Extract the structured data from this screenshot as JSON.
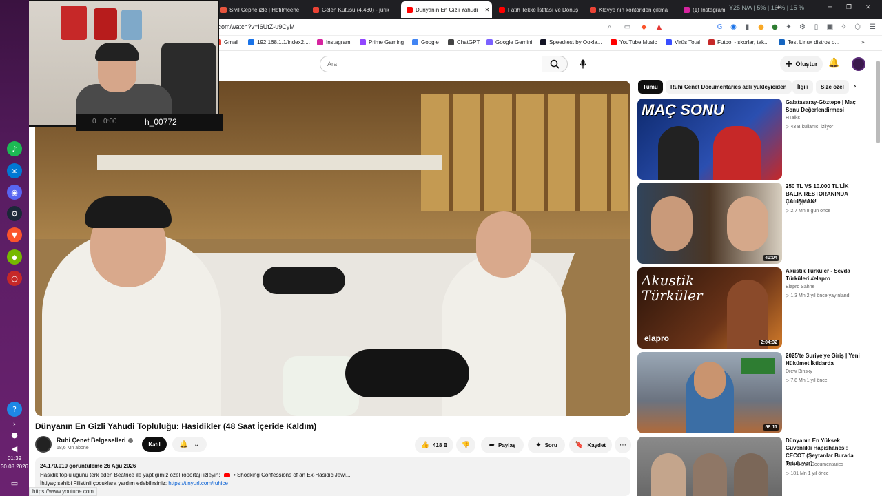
{
  "taskbar": {
    "time": "01:39",
    "date": "30.08.2026"
  },
  "browser": {
    "tabs": [
      {
        "label": "Sivil Cephe izle | Hdfilmcehe",
        "color": "#e8553e"
      },
      {
        "label": "Gelen Kutusu (4.430) - jurik",
        "color": "#ea4335"
      },
      {
        "label": "Dünyanın En Gizli Yahudi",
        "color": "#ff0000"
      },
      {
        "label": "Fatih Tekke İstifası ve Dönüş",
        "color": "#ff0000"
      },
      {
        "label": "Klavye nin kontorlden çıkma",
        "color": "#ea4335"
      },
      {
        "label": "(1) Instagram",
        "color": "#d6249f"
      }
    ],
    "tray_text": "Y25 N/A | 5% | 16 % | 15 %",
    "url": ".com/watch?v=I6UtZ-u9CyM",
    "bookmarks": [
      {
        "label": "Gmail",
        "color": "#ea4335"
      },
      {
        "label": "192.168.1.1/index2....",
        "color": "#1a73e8"
      },
      {
        "label": "Instagram",
        "color": "#d6249f"
      },
      {
        "label": "Prime Gaming",
        "color": "#9146ff"
      },
      {
        "label": "Google",
        "color": "#4285f4"
      },
      {
        "label": "ChatGPT",
        "color": "#444444"
      },
      {
        "label": "Google Gemini",
        "color": "#7b61ff"
      },
      {
        "label": "Speedtest by Ookla...",
        "color": "#141526"
      },
      {
        "label": "YouTube Music",
        "color": "#ff0000"
      },
      {
        "label": "Virüs Total",
        "color": "#394eff"
      },
      {
        "label": "Futbol - skorlar, tak...",
        "color": "#c62828"
      },
      {
        "label": "Test Linux distros o...",
        "color": "#1565c0"
      }
    ],
    "status_url": "https://www.youtube.com"
  },
  "webcam": {
    "counter_a": "0",
    "counter_b": "0:00",
    "username": "h_00772"
  },
  "youtube": {
    "search_placeholder": "Ara",
    "create_label": "Oluştur",
    "video_title": "Dünyanın En Gizli Yahudi Topluluğu: Hasidikler (48 Saat İçeride Kaldım)",
    "channel_name": "Ruhi Çenet Belgeselleri",
    "subscribers": "18,6 Mn abone",
    "join_label": "Katıl",
    "like_count": "418 B",
    "share_label": "Paylaş",
    "ask_label": "Soru",
    "save_label": "Kaydet",
    "description": {
      "stats": "24.170.010 görüntüleme  26 Ağu 2026",
      "line2": "Hasidik topluluğunu terk eden Beatrice ile yaptığımız özel röportajı izleyin:",
      "line2_link": "• Shocking Confessions of an Ex-Hasidic Jewi...",
      "line3": "İhtiyaç sahibi Filistinli çocuklara yardım edebilirsiniz: ",
      "line3_link": "https://tinyurl.com/ruhice"
    }
  },
  "sidebar": {
    "chips": [
      "Tümü",
      "Ruhi Cenet Documentaries adlı yükleyiciden",
      "İlgili",
      "Size özel"
    ],
    "recommendations": [
      {
        "title": "Galatasaray-Göztepe | Maç Sonu Değerlendirmesi",
        "channel": "HTalks",
        "meta": "▷ 43 B kullanıcı izliyor",
        "duration": "",
        "thumb_text": "MAÇ SONU",
        "thumb_color": "#1a3d8f"
      },
      {
        "title": "250 TL VS 10.000 TL'LİK BALIK RESTORANINDA ÇALIŞMAK!",
        "channel": "Orkun Işıtmak",
        "meta": "▷ 2,7 Mn   8 gün önce",
        "duration": "40:04",
        "thumb_text": "",
        "thumb_color": "#2f4a3a"
      },
      {
        "title": "Akustik Türküler - Sevda Türküleri #elapro",
        "channel": "Elapro Sahne",
        "meta": "▷ 1,3 Mn   2 yıl önce yayınlandı",
        "duration": "2:04:32",
        "thumb_text": "Akustik Türküler",
        "thumb_color": "#5a2a14"
      },
      {
        "title": "2025'te Suriye'ye Giriş | Yeni Hükümet İktidarda",
        "channel": "Drew Binsky",
        "meta": "▷ 7,8 Mn   1 yıl önce",
        "duration": "58:11",
        "thumb_text": "",
        "thumb_color": "#7a8a98"
      },
      {
        "title": "Dünyanın En Yüksek Güvenlikli Hapishanesi: CECOT (Şeytanlar Burada Tutuluyor)",
        "channel": "Ruhi Cenet Documentaries",
        "meta": "▷ 181 Mn   1 yıl önce",
        "duration": "",
        "thumb_text": "",
        "thumb_color": "#6d6d6d"
      }
    ]
  }
}
